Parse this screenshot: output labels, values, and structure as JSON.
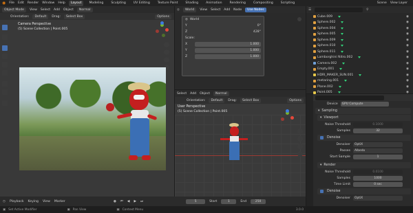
{
  "topbar": {
    "menus": [
      "File",
      "Edit",
      "Render",
      "Window",
      "Help"
    ],
    "tabs": [
      "Layout",
      "Modeling",
      "Sculpting",
      "UV Editing",
      "Texture Paint",
      "Shading",
      "Animation",
      "Rendering",
      "Compositing",
      "Scripting"
    ],
    "active_tab": "Layout",
    "scene": "Scene",
    "view_layer": "View Layer",
    "search_count": "2"
  },
  "left_view": {
    "mode": "Object Mode",
    "menus": [
      "View",
      "Select",
      "Add",
      "Object"
    ],
    "shading": "Normal",
    "orientation_label": "Orientation:",
    "orientation": "Default",
    "drag_label": "Drag:",
    "drag": "Select Box",
    "options": "Options",
    "camera_title": "Camera Perspective",
    "camera_sub": "(5) Scene Collection | Point.005"
  },
  "node_panel": {
    "menus": [
      "View",
      "Select",
      "Add",
      "Node"
    ],
    "use_nodes": "Use Nodes",
    "world": "World",
    "y_label": "Y",
    "y_val": "0°",
    "z_label": "Z",
    "z_val": "428°",
    "scale_label": "Scale:",
    "x_label": "X",
    "x_scale": "1.000",
    "ys_label": "Y",
    "y_scale": "1.000",
    "zs_label": "Z",
    "z_scale": "1.000"
  },
  "right_view": {
    "menus": [
      "Select",
      "Add",
      "Object"
    ],
    "shading": "Normal",
    "orientation_label": "Orientation:",
    "orientation": "Default",
    "drag_label": "Drag:",
    "drag": "Select Box",
    "options": "Options",
    "title": "User Perspective",
    "sub": "(5) Scene Collection | Point.005"
  },
  "outliner": {
    "items": [
      "Cube.009",
      "Sphere.002",
      "Sphere.004",
      "Sphere.005",
      "Sphere.009",
      "Sphere.010",
      "Sphere.011",
      "Lamborghini Nitro.002",
      "Camera.002",
      "Empty.001",
      "HDRI_MAKER_SUN.001",
      "metaring.001",
      "Plane.002",
      "Point.005"
    ]
  },
  "properties": {
    "device_label": "Device",
    "device": "GPU Compute",
    "sampling": "Sampling",
    "viewport": "Viewport",
    "noise_threshold": "Noise Threshold",
    "noise_val": "0.1000",
    "samples": "Samples",
    "samples_val": "32",
    "denoise": "Denoise",
    "denoiser": "Denoiser",
    "denoiser_val": "OptiX",
    "passes": "Passes",
    "passes_val": "Albedo",
    "start_sample": "Start Sample",
    "start_val": "1",
    "render": "Render",
    "r_noise_threshold": "Noise Threshold",
    "r_noise_val": "0.0100",
    "r_samples": "Samples",
    "r_samples_val": "1000",
    "time_limit": "Time Limit",
    "time_val": "0 sec",
    "r_denoise": "Denoise",
    "r_denoiser": "Denoiser",
    "r_denoiser_val": "OptiX"
  },
  "timeline": {
    "menus": [
      "Playback",
      "Keying",
      "View",
      "Marker"
    ],
    "frame": "5",
    "start_label": "Start",
    "start": "1",
    "end_label": "End",
    "end": "250"
  },
  "statusbar": {
    "items": [
      "Set Active Modifier",
      "Pan View",
      "Context Menu"
    ],
    "version": "3.0.0"
  }
}
